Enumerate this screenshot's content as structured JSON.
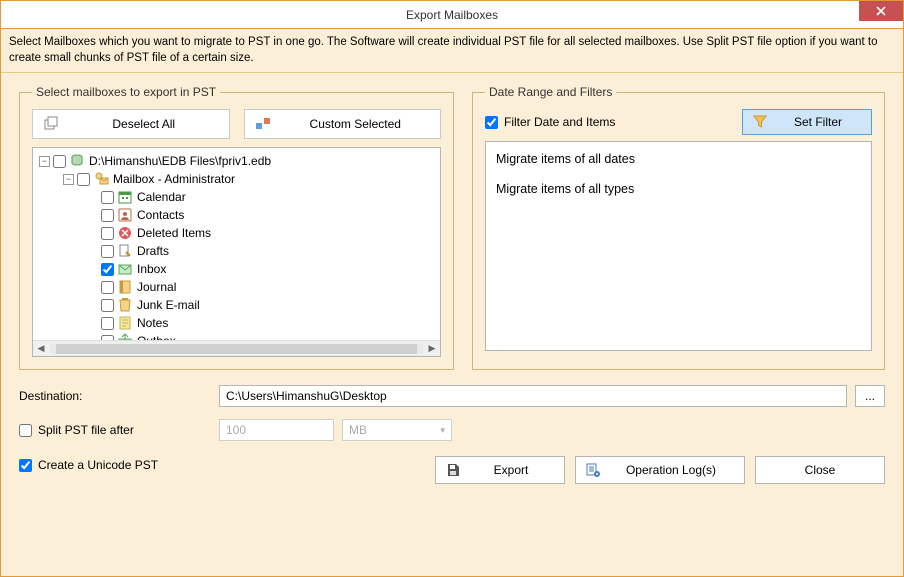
{
  "title": "Export Mailboxes",
  "instructions": "Select Mailboxes which you want to migrate to PST in one go. The Software will create individual PST file for all selected mailboxes. Use Split PST file option if you want to create small chunks of PST file of a certain size.",
  "leftPanel": {
    "legend": "Select mailboxes to export in PST",
    "deselectAll": "Deselect All",
    "customSelected": "Custom Selected",
    "tree": {
      "root": {
        "label": "D:\\Himanshu\\EDB Files\\fpriv1.edb",
        "expanded": true,
        "checked": false,
        "icon": "database"
      },
      "mailbox": {
        "label": "Mailbox - Administrator",
        "expanded": true,
        "checked": false,
        "icon": "mailbox"
      },
      "items": [
        {
          "label": "Calendar",
          "checked": false,
          "icon": "calendar"
        },
        {
          "label": "Contacts",
          "checked": false,
          "icon": "contacts"
        },
        {
          "label": "Deleted Items",
          "checked": false,
          "icon": "deleted"
        },
        {
          "label": "Drafts",
          "checked": false,
          "icon": "drafts"
        },
        {
          "label": "Inbox",
          "checked": true,
          "icon": "inbox"
        },
        {
          "label": "Journal",
          "checked": false,
          "icon": "journal"
        },
        {
          "label": "Junk E-mail",
          "checked": false,
          "icon": "junk"
        },
        {
          "label": "Notes",
          "checked": false,
          "icon": "notes"
        },
        {
          "label": "Outbox",
          "checked": false,
          "icon": "outbox"
        }
      ]
    }
  },
  "rightPanel": {
    "legend": "Date Range and Filters",
    "filterCheckLabel": "Filter Date and Items",
    "filterChecked": true,
    "setFilter": "Set Filter",
    "summary": {
      "line1": "Migrate items of all dates",
      "line2": "Migrate items of all types"
    }
  },
  "destination": {
    "label": "Destination:",
    "value": "C:\\Users\\HimanshuG\\Desktop",
    "browse": "..."
  },
  "splitPst": {
    "label": "Split PST file after",
    "checked": false,
    "size": "100",
    "unit": "MB"
  },
  "unicodePst": {
    "label": "Create a Unicode PST",
    "checked": true
  },
  "actions": {
    "export": "Export",
    "logs": "Operation Log(s)",
    "close": "Close"
  }
}
